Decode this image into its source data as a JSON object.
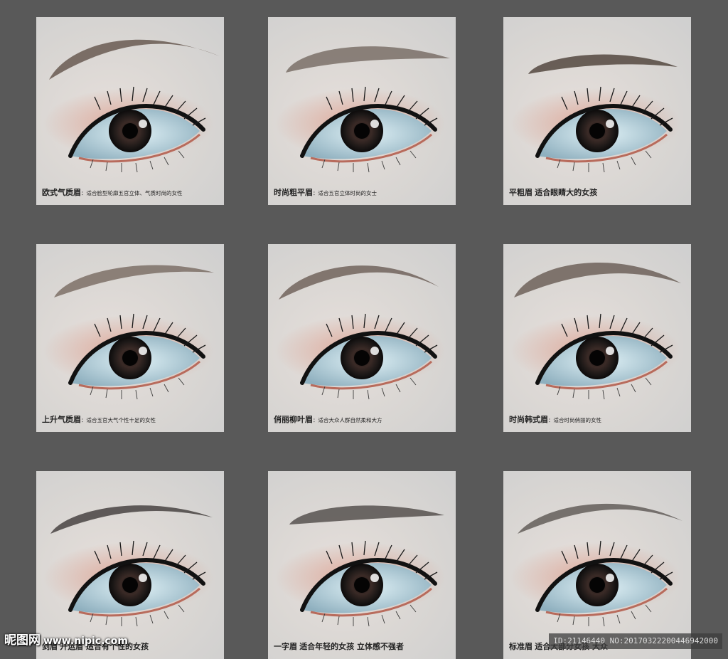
{
  "cards": [
    {
      "name": "欧式气质眉",
      "desc": "：适合脸型轮廓五官立体、气质时尚的女性",
      "brow": "arch",
      "tone": "#5a4a40"
    },
    {
      "name": "时尚粗平眉",
      "desc": "：适合五官立体时尚的女士",
      "brow": "thick-flat",
      "tone": "#6e625a"
    },
    {
      "name": "平粗眉",
      "desc": "适合眼睛大的女孩",
      "brow": "flat-thick",
      "tone": "#4b3e36"
    },
    {
      "name": "上升气质眉",
      "desc": "：适合五官大气个性十足的女性",
      "brow": "rising",
      "tone": "#6a5a50"
    },
    {
      "name": "俏丽柳叶眉",
      "desc": "：适合大众人群自然柔和大方",
      "brow": "willow",
      "tone": "#5e4f46"
    },
    {
      "name": "时尚韩式眉",
      "desc": "：适合时尚俏丽的女性",
      "brow": "korean",
      "tone": "#5a4c44"
    },
    {
      "name": "剑眉",
      "desc": "开运眉 适合有个性的女孩",
      "brow": "sword",
      "tone": "#3e3a38"
    },
    {
      "name": "一字眉",
      "desc": "适合年轻的女孩 立体感不强者",
      "brow": "straight",
      "tone": "#4a4542"
    },
    {
      "name": "标准眉",
      "desc": "适合大部分女孩 大众",
      "brow": "standard",
      "tone": "#4e4844"
    }
  ],
  "watermark": {
    "site_name": "昵图网",
    "url": "www.nipic.com",
    "id_text": "ID:21146440 NO:20170322200446942000"
  }
}
